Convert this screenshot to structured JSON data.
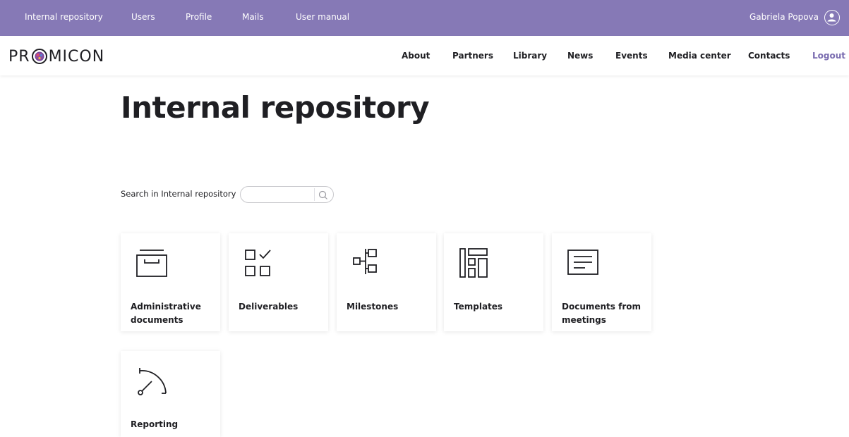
{
  "topbar": {
    "links": [
      "Internal repository",
      "Users",
      "Profile",
      "Mails",
      "User manual"
    ],
    "user_name": "Gabriela Popova"
  },
  "brand": {
    "logo_text_left": "PR",
    "logo_text_right": "MICON"
  },
  "main_nav": {
    "links": [
      "About",
      "Partners",
      "Library",
      "News",
      "Events",
      "Media center",
      "Contacts"
    ],
    "logout": "Logout"
  },
  "page": {
    "title": "Internal repository"
  },
  "search": {
    "label": "Search in Internal repository",
    "value": "",
    "placeholder": ""
  },
  "cards": [
    {
      "label": "Administrative documents",
      "icon": "archive-box-icon"
    },
    {
      "label": "Deliverables",
      "icon": "checklist-icon"
    },
    {
      "label": "Milestones",
      "icon": "milestone-tree-icon"
    },
    {
      "label": "Templates",
      "icon": "template-layout-icon"
    },
    {
      "label": "Documents from meetings",
      "icon": "document-lines-icon"
    },
    {
      "label": "Reporting",
      "icon": "gauge-icon"
    }
  ],
  "colors": {
    "topbar_bg": "#8679b6",
    "accent": "#7a6cb0",
    "text": "#1f1f23"
  }
}
